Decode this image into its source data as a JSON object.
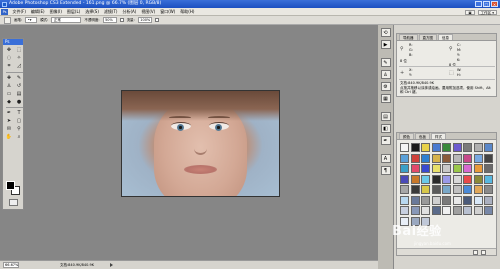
{
  "window": {
    "title": "Adobe Photoshop CS3 Extended - 161.png @ 66.7% (图层 0, RGB/8)"
  },
  "menubar": {
    "logo": "Ps",
    "items": [
      "文件(F)",
      "编辑(E)",
      "图像(I)",
      "图层(L)",
      "选择(S)",
      "滤镜(T)",
      "分析(A)",
      "视图(V)",
      "窗口(W)",
      "帮助(H)"
    ],
    "workspace_label": "工作区 ▾"
  },
  "options_bar": {
    "brush_label": "画笔:",
    "mode_label": "模式:",
    "mode_value": "正常",
    "opacity_label": "不透明度:",
    "opacity_value": "50%",
    "flow_label": "流量:",
    "flow_value": "100%"
  },
  "toolbox": {
    "header": "Ps"
  },
  "statusbar": {
    "zoom": "66.67%",
    "doc": "文档:840.9K/840.9K"
  },
  "info_panel": {
    "tabs": [
      "导航器",
      "直方图",
      "信息"
    ],
    "r_label": "R:",
    "g_label": "G:",
    "b_label": "B:",
    "c_label": "C:",
    "m_label": "M:",
    "y_label": "Y:",
    "k_label": "K:",
    "bits_left": "8 位",
    "bits_right": "8 位",
    "x_label": "X:",
    "y2_label": "Y:",
    "w_label": "W:",
    "h_label": "H:",
    "doc": "文档:840.9K/840.9K",
    "hint": "点按并拖移以涂抹或绘画。要用附加选项，使用 Shift、Alt 和 Ctrl 键。"
  },
  "styles_panel": {
    "tabs": [
      "颜色",
      "色板",
      "样式"
    ],
    "swatches": [
      "#f4f4f4",
      "#1a1a1a",
      "#e8d24a",
      "#4a7bd0",
      "#3a8a3a",
      "#6d5bd0",
      "#7c7c7c",
      "#b0b0b0",
      "#5b88c9",
      "#5aa0d8",
      "#d0423a",
      "#2f7fd0",
      "#d6b24a",
      "#8a5b3a",
      "#b8b8b8",
      "#c84a8a",
      "#78a8e0",
      "#444444",
      "#3aa0c8",
      "#e24a6a",
      "#3a4ad0",
      "#e8e06a",
      "#c8c8c8",
      "#9ac84a",
      "#d86ad0",
      "#e89a3a",
      "#6a6a6a",
      "#4a4ab8",
      "#c8782a",
      "#6ac8e8",
      "#2a2a2a",
      "#9a9ae8",
      "#d8d8d8",
      "#e84a4a",
      "#8a8a3a",
      "#58b8e0",
      "#a8a8a8",
      "#3a3a3a",
      "#d8c84a",
      "#5a5a5a",
      "#7aa8c8",
      "#c0c0c0",
      "#4a8ad8",
      "#e0a85a",
      "#8a8a8a",
      "#b8d8f0",
      "#6a7a9a",
      "#9a9a9a",
      "#cfcfcf",
      "#7a7a7a",
      "#e8e8e8",
      "#4a5a7a",
      "#d8e8f8",
      "#aab0c0",
      "#c8d0e0",
      "#8898b8",
      "#e0e0e0",
      "#5a6a8a",
      "#f0f0f0",
      "#a0a0a0",
      "#b8c0d0",
      "#d0d0d0",
      "#7888a8",
      "#e8eef6",
      "#9aa8c0",
      "#c0c8d8"
    ]
  },
  "watermark": {
    "text": "Bai",
    "cn": "经验",
    "sub": "jingyan.baidu.com"
  },
  "colors": {
    "title_bar": "#2a5fcf",
    "menu_bg": "#e9e7e1",
    "workspace": "#868686",
    "panel_bg": "#ecebe6"
  }
}
